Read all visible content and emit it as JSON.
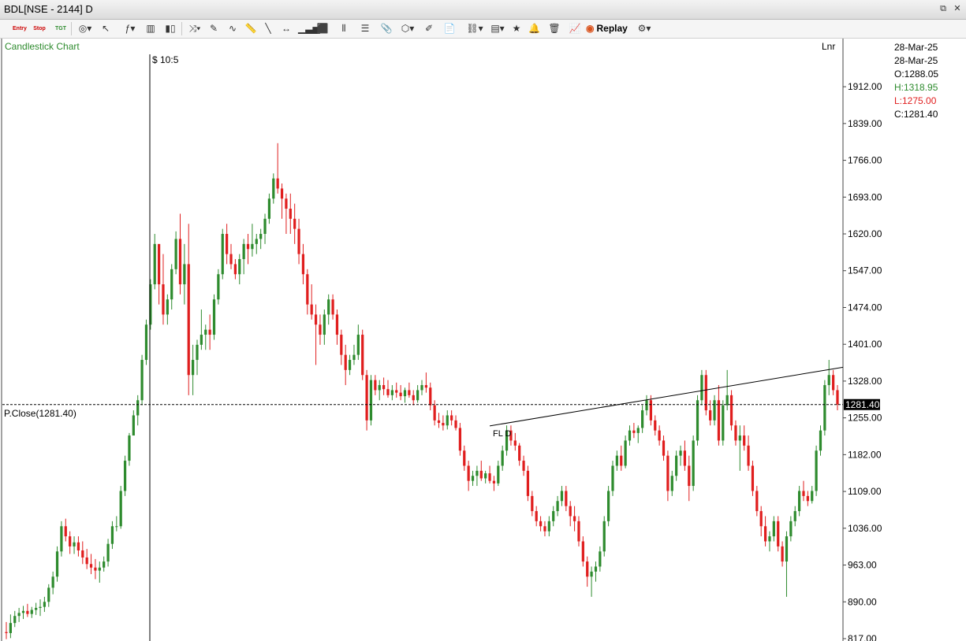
{
  "window": {
    "title": "BDL[NSE - 2144] D"
  },
  "toolbar": {
    "entry_label": "Entry",
    "stop_label": "Stop",
    "tgt_label": "TGT",
    "replay_label": "Replay"
  },
  "chart_labels": {
    "type_label": "Candlestick Chart",
    "cursor_label": "$ 10:5",
    "scale_label": "Lnr",
    "trend_label": "FL D",
    "prev_close_label": "P.Close(1281.40)",
    "price_badge": "1281.40"
  },
  "info_panel": {
    "date1": "28-Mar-25",
    "date2": "28-Mar-25",
    "open": "O:1288.05",
    "high": "H:1318.95",
    "low": "L:1275.00",
    "close": "C:1281.40"
  },
  "colors": {
    "up": "#2e8b2e",
    "down": "#e01e1e",
    "high_text": "#2e8b2e",
    "low_text": "#e01e1e",
    "chart_title": "#2e8b2e"
  },
  "chart_data": {
    "type": "candlestick",
    "title": "Candlestick Chart",
    "ylim": [
      817,
      1945
    ],
    "yticks": [
      1912,
      1839,
      1766,
      1693,
      1620,
      1547,
      1474,
      1401,
      1328,
      1255,
      1182,
      1109,
      1036,
      963,
      890,
      817
    ],
    "ytick_labels": [
      "1912.00",
      "1839.00",
      "1766.00",
      "1693.00",
      "1620.00",
      "1547.00",
      "1474.00",
      "1401.00",
      "1328.00",
      "1255.00",
      "1182.00",
      "1109.00",
      "1036.00",
      "963.00",
      "890.00",
      "817.00"
    ],
    "prev_close": 1281.4,
    "trendline": {
      "start": [
        1239,
        114
      ],
      "end": [
        1383,
        217
      ]
    },
    "candles": [
      [
        830,
        850,
        816,
        828
      ],
      [
        828,
        865,
        818,
        848
      ],
      [
        848,
        872,
        840,
        862
      ],
      [
        862,
        878,
        850,
        868
      ],
      [
        868,
        882,
        856,
        872
      ],
      [
        872,
        886,
        860,
        866
      ],
      [
        866,
        880,
        858,
        874
      ],
      [
        874,
        888,
        864,
        878
      ],
      [
        878,
        895,
        862,
        880
      ],
      [
        880,
        900,
        870,
        890
      ],
      [
        890,
        925,
        880,
        918
      ],
      [
        918,
        950,
        905,
        940
      ],
      [
        940,
        1000,
        930,
        990
      ],
      [
        990,
        1050,
        980,
        1040
      ],
      [
        1040,
        1055,
        1010,
        1020
      ],
      [
        1020,
        1030,
        985,
        1000
      ],
      [
        1000,
        1020,
        985,
        1008
      ],
      [
        1008,
        1020,
        980,
        992
      ],
      [
        992,
        1010,
        965,
        978
      ],
      [
        978,
        995,
        955,
        965
      ],
      [
        965,
        985,
        945,
        958
      ],
      [
        958,
        975,
        935,
        952
      ],
      [
        952,
        970,
        928,
        958
      ],
      [
        958,
        980,
        950,
        970
      ],
      [
        970,
        1015,
        960,
        1005
      ],
      [
        1005,
        1050,
        995,
        1040
      ],
      [
        1040,
        1060,
        1030,
        1040
      ],
      [
        1040,
        1120,
        1035,
        1110
      ],
      [
        1110,
        1180,
        1100,
        1170
      ],
      [
        1170,
        1225,
        1160,
        1220
      ],
      [
        1220,
        1270,
        1240,
        1260
      ],
      [
        1260,
        1300,
        1240,
        1290
      ],
      [
        1290,
        1380,
        1280,
        1370
      ],
      [
        1370,
        1450,
        1360,
        1440
      ],
      [
        1440,
        1530,
        1430,
        1520
      ],
      [
        1520,
        1620,
        1510,
        1600
      ],
      [
        1600,
        1560,
        1480,
        1520
      ],
      [
        1520,
        1580,
        1440,
        1460
      ],
      [
        1460,
        1500,
        1440,
        1490
      ],
      [
        1490,
        1560,
        1470,
        1550
      ],
      [
        1550,
        1625,
        1540,
        1610
      ],
      [
        1610,
        1660,
        1500,
        1520
      ],
      [
        1520,
        1600,
        1480,
        1560
      ],
      [
        1560,
        1640,
        1300,
        1340
      ],
      [
        1340,
        1400,
        1300,
        1370
      ],
      [
        1370,
        1410,
        1340,
        1400
      ],
      [
        1400,
        1470,
        1390,
        1420
      ],
      [
        1420,
        1440,
        1390,
        1430
      ],
      [
        1430,
        1460,
        1390,
        1420
      ],
      [
        1420,
        1500,
        1410,
        1490
      ],
      [
        1490,
        1550,
        1480,
        1540
      ],
      [
        1540,
        1630,
        1530,
        1620
      ],
      [
        1620,
        1640,
        1560,
        1580
      ],
      [
        1580,
        1600,
        1550,
        1560
      ],
      [
        1560,
        1570,
        1530,
        1540
      ],
      [
        1540,
        1580,
        1520,
        1570
      ],
      [
        1570,
        1610,
        1540,
        1600
      ],
      [
        1600,
        1620,
        1560,
        1590
      ],
      [
        1590,
        1640,
        1575,
        1600
      ],
      [
        1600,
        1620,
        1580,
        1610
      ],
      [
        1610,
        1630,
        1590,
        1620
      ],
      [
        1620,
        1660,
        1600,
        1650
      ],
      [
        1650,
        1700,
        1640,
        1690
      ],
      [
        1690,
        1740,
        1680,
        1730
      ],
      [
        1730,
        1800,
        1700,
        1710
      ],
      [
        1710,
        1720,
        1650,
        1690
      ],
      [
        1690,
        1700,
        1620,
        1670
      ],
      [
        1670,
        1700,
        1620,
        1650
      ],
      [
        1650,
        1680,
        1600,
        1630
      ],
      [
        1630,
        1650,
        1560,
        1580
      ],
      [
        1580,
        1600,
        1520,
        1540
      ],
      [
        1540,
        1550,
        1460,
        1480
      ],
      [
        1480,
        1520,
        1450,
        1460
      ],
      [
        1460,
        1480,
        1360,
        1440
      ],
      [
        1440,
        1460,
        1400,
        1420
      ],
      [
        1420,
        1470,
        1400,
        1460
      ],
      [
        1460,
        1500,
        1440,
        1490
      ],
      [
        1490,
        1500,
        1450,
        1460
      ],
      [
        1460,
        1470,
        1400,
        1420
      ],
      [
        1420,
        1430,
        1360,
        1380
      ],
      [
        1380,
        1400,
        1320,
        1350
      ],
      [
        1350,
        1380,
        1340,
        1370
      ],
      [
        1370,
        1400,
        1360,
        1380
      ],
      [
        1380,
        1440,
        1370,
        1420
      ],
      [
        1420,
        1430,
        1330,
        1340
      ],
      [
        1340,
        1350,
        1230,
        1250
      ],
      [
        1250,
        1340,
        1240,
        1330
      ],
      [
        1330,
        1340,
        1300,
        1310
      ],
      [
        1310,
        1330,
        1290,
        1320
      ],
      [
        1320,
        1335,
        1300,
        1312
      ],
      [
        1312,
        1330,
        1295,
        1300
      ],
      [
        1300,
        1320,
        1290,
        1310
      ],
      [
        1310,
        1325,
        1295,
        1305
      ],
      [
        1305,
        1320,
        1290,
        1298
      ],
      [
        1298,
        1315,
        1285,
        1310
      ],
      [
        1310,
        1325,
        1295,
        1300
      ],
      [
        1300,
        1310,
        1280,
        1290
      ],
      [
        1290,
        1320,
        1285,
        1310
      ],
      [
        1310,
        1330,
        1300,
        1320
      ],
      [
        1320,
        1345,
        1305,
        1315
      ],
      [
        1315,
        1325,
        1270,
        1280
      ],
      [
        1280,
        1290,
        1240,
        1250
      ],
      [
        1250,
        1265,
        1235,
        1245
      ],
      [
        1245,
        1260,
        1230,
        1240
      ],
      [
        1240,
        1270,
        1232,
        1260
      ],
      [
        1260,
        1270,
        1240,
        1250
      ],
      [
        1250,
        1260,
        1230,
        1235
      ],
      [
        1235,
        1245,
        1180,
        1190
      ],
      [
        1190,
        1200,
        1150,
        1160
      ],
      [
        1160,
        1170,
        1110,
        1130
      ],
      [
        1130,
        1150,
        1120,
        1140
      ],
      [
        1140,
        1160,
        1120,
        1150
      ],
      [
        1150,
        1170,
        1130,
        1135
      ],
      [
        1135,
        1150,
        1125,
        1145
      ],
      [
        1145,
        1160,
        1125,
        1130
      ],
      [
        1130,
        1140,
        1110,
        1125
      ],
      [
        1125,
        1170,
        1120,
        1160
      ],
      [
        1160,
        1200,
        1150,
        1190
      ],
      [
        1190,
        1240,
        1180,
        1230
      ],
      [
        1230,
        1240,
        1200,
        1210
      ],
      [
        1210,
        1225,
        1190,
        1200
      ],
      [
        1200,
        1205,
        1160,
        1170
      ],
      [
        1170,
        1180,
        1140,
        1150
      ],
      [
        1150,
        1160,
        1090,
        1100
      ],
      [
        1100,
        1110,
        1060,
        1070
      ],
      [
        1070,
        1080,
        1040,
        1050
      ],
      [
        1050,
        1060,
        1030,
        1040
      ],
      [
        1040,
        1050,
        1020,
        1030
      ],
      [
        1030,
        1060,
        1020,
        1050
      ],
      [
        1050,
        1080,
        1040,
        1070
      ],
      [
        1070,
        1100,
        1060,
        1090
      ],
      [
        1090,
        1120,
        1080,
        1110
      ],
      [
        1110,
        1120,
        1070,
        1080
      ],
      [
        1080,
        1090,
        1040,
        1060
      ],
      [
        1060,
        1080,
        1030,
        1050
      ],
      [
        1050,
        1060,
        1000,
        1010
      ],
      [
        1010,
        1020,
        960,
        970
      ],
      [
        970,
        980,
        920,
        940
      ],
      [
        940,
        960,
        900,
        950
      ],
      [
        950,
        970,
        930,
        960
      ],
      [
        960,
        1000,
        950,
        990
      ],
      [
        990,
        1060,
        980,
        1050
      ],
      [
        1050,
        1120,
        1040,
        1110
      ],
      [
        1110,
        1170,
        1100,
        1160
      ],
      [
        1160,
        1190,
        1150,
        1180
      ],
      [
        1180,
        1200,
        1150,
        1160
      ],
      [
        1160,
        1220,
        1155,
        1210
      ],
      [
        1210,
        1240,
        1200,
        1230
      ],
      [
        1230,
        1245,
        1215,
        1225
      ],
      [
        1225,
        1240,
        1205,
        1235
      ],
      [
        1235,
        1280,
        1225,
        1270
      ],
      [
        1270,
        1300,
        1260,
        1290
      ],
      [
        1290,
        1300,
        1240,
        1250
      ],
      [
        1250,
        1260,
        1220,
        1230
      ],
      [
        1230,
        1240,
        1200,
        1210
      ],
      [
        1210,
        1220,
        1170,
        1180
      ],
      [
        1180,
        1190,
        1090,
        1110
      ],
      [
        1110,
        1150,
        1100,
        1140
      ],
      [
        1140,
        1190,
        1130,
        1180
      ],
      [
        1180,
        1200,
        1160,
        1190
      ],
      [
        1190,
        1210,
        1150,
        1160
      ],
      [
        1160,
        1180,
        1090,
        1120
      ],
      [
        1120,
        1220,
        1110,
        1210
      ],
      [
        1210,
        1300,
        1200,
        1290
      ],
      [
        1290,
        1350,
        1280,
        1340
      ],
      [
        1340,
        1350,
        1260,
        1270
      ],
      [
        1270,
        1290,
        1240,
        1250
      ],
      [
        1250,
        1300,
        1240,
        1290
      ],
      [
        1290,
        1320,
        1200,
        1210
      ],
      [
        1210,
        1290,
        1200,
        1280
      ],
      [
        1280,
        1350,
        1270,
        1300
      ],
      [
        1300,
        1310,
        1230,
        1240
      ],
      [
        1240,
        1250,
        1200,
        1210
      ],
      [
        1210,
        1240,
        1150,
        1220
      ],
      [
        1220,
        1240,
        1190,
        1200
      ],
      [
        1200,
        1220,
        1150,
        1160
      ],
      [
        1160,
        1170,
        1100,
        1110
      ],
      [
        1110,
        1120,
        1060,
        1070
      ],
      [
        1070,
        1080,
        1020,
        1040
      ],
      [
        1040,
        1060,
        1000,
        1010
      ],
      [
        1010,
        1030,
        990,
        1020
      ],
      [
        1020,
        1060,
        1010,
        1050
      ],
      [
        1050,
        1060,
        990,
        1000
      ],
      [
        1000,
        1010,
        960,
        970
      ],
      [
        970,
        1030,
        900,
        1020
      ],
      [
        1020,
        1060,
        1010,
        1050
      ],
      [
        1050,
        1080,
        1040,
        1070
      ],
      [
        1070,
        1120,
        1060,
        1110
      ],
      [
        1110,
        1130,
        1090,
        1100
      ],
      [
        1100,
        1110,
        1080,
        1090
      ],
      [
        1090,
        1120,
        1085,
        1110
      ],
      [
        1110,
        1200,
        1100,
        1190
      ],
      [
        1190,
        1240,
        1180,
        1230
      ],
      [
        1230,
        1330,
        1220,
        1320
      ],
      [
        1320,
        1370,
        1300,
        1340
      ],
      [
        1340,
        1350,
        1300,
        1310
      ],
      [
        1310,
        1320,
        1270,
        1281.4
      ]
    ]
  }
}
